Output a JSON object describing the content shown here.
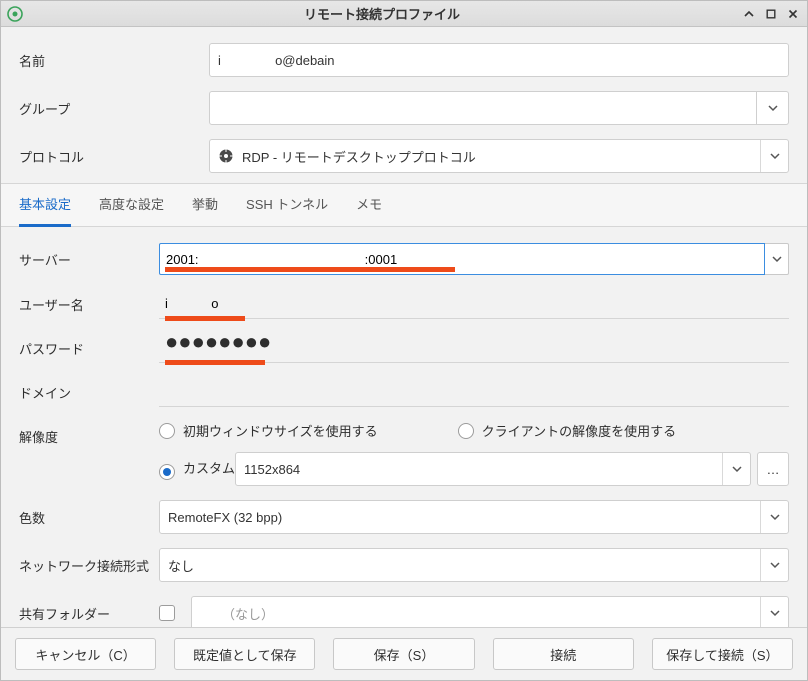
{
  "titlebar": {
    "title": "リモート接続プロファイル"
  },
  "upper": {
    "name_label": "名前",
    "name_value": "i               o@debain",
    "group_label": "グループ",
    "protocol_label": "プロトコル",
    "protocol_value": "RDP - リモートデスクトッププロトコル"
  },
  "tabs": {
    "basic": "基本設定",
    "advanced": "高度な設定",
    "behavior": "挙動",
    "ssh": "SSH トンネル",
    "memo": "メモ"
  },
  "form": {
    "server_label": "サーバー",
    "server_value": "2001:                                              :0001",
    "user_label": "ユーザー名",
    "user_value": "i            o",
    "password_label": "パスワード",
    "password_value": "●●●●●●●●",
    "domain_label": "ドメイン",
    "res_label": "解像度",
    "res_opt_initial": "初期ウィンドウサイズを使用する",
    "res_opt_client": "クライアントの解像度を使用する",
    "res_opt_custom": "カスタム",
    "res_custom_value": "1152x864",
    "color_label": "色数",
    "color_value": "RemoteFX (32 bpp)",
    "net_label": "ネットワーク接続形式",
    "net_value": "なし",
    "share_label": "共有フォルダー",
    "share_placeholder": "（なし）"
  },
  "footer": {
    "cancel": "キャンセル（C）",
    "save_default": "既定値として保存",
    "save": "保存（S）",
    "connect": "接続",
    "save_connect": "保存して接続（S）"
  }
}
